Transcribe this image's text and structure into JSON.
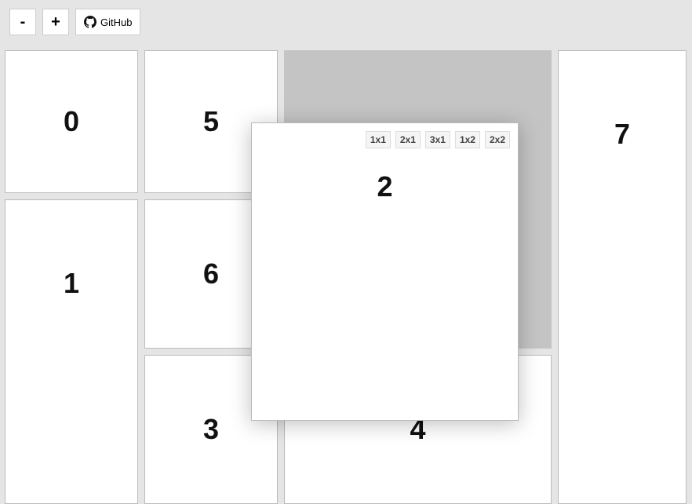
{
  "toolbar": {
    "minus_label": "-",
    "plus_label": "+",
    "github_label": "GitHub"
  },
  "size_options": [
    "1x1",
    "2x1",
    "3x1",
    "1x2",
    "2x2"
  ],
  "tiles": {
    "0": {
      "label": "0"
    },
    "1": {
      "label": "1"
    },
    "2": {
      "label": "2"
    },
    "3": {
      "label": "3"
    },
    "4": {
      "label": "4"
    },
    "5": {
      "label": "5"
    },
    "6": {
      "label": "6"
    },
    "7": {
      "label": "7"
    }
  }
}
